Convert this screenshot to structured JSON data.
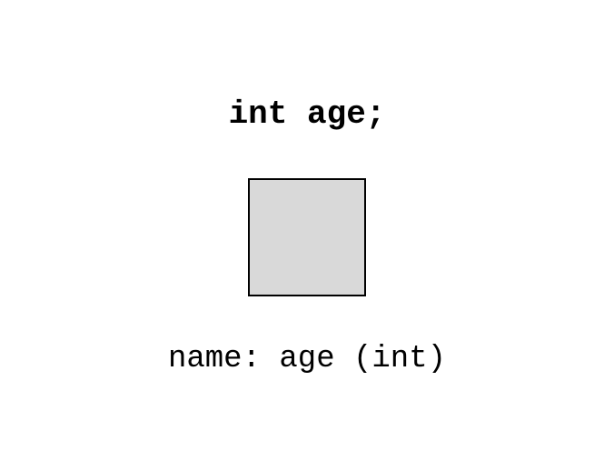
{
  "declaration": "int age;",
  "label": "name: age (int)"
}
